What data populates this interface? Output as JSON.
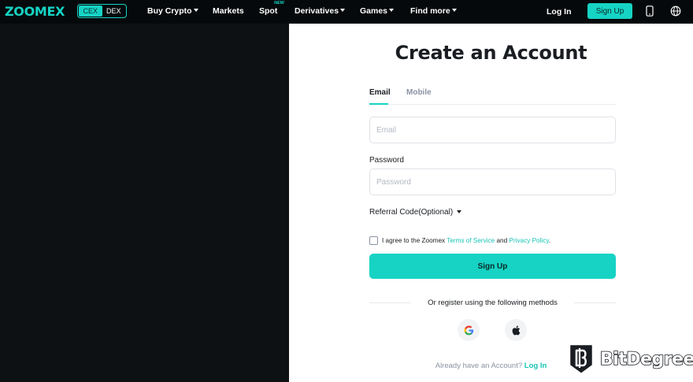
{
  "nav": {
    "logo": "ZOOMEX",
    "switch": {
      "cex": "CEX",
      "dex": "DEX"
    },
    "items": [
      {
        "label": "Buy Crypto",
        "dropdown": true
      },
      {
        "label": "Markets",
        "dropdown": false
      },
      {
        "label": "Spot",
        "dropdown": false,
        "badge": "NEW"
      },
      {
        "label": "Derivatives",
        "dropdown": true
      },
      {
        "label": "Games",
        "dropdown": true
      },
      {
        "label": "Find more",
        "dropdown": true
      }
    ],
    "login": "Log In",
    "signup": "Sign Up",
    "icons": [
      "mobile-icon",
      "globe-icon"
    ]
  },
  "form": {
    "title": "Create an Account",
    "tabs": [
      {
        "label": "Email",
        "active": true
      },
      {
        "label": "Mobile",
        "active": false
      }
    ],
    "email_placeholder": "Email",
    "password_label": "Password",
    "password_placeholder": "Password",
    "referral_label": "Referral Code(Optional)",
    "agree_prefix": "I agree to the Zoomex",
    "terms_link": "Terms of Service",
    "and": "and",
    "privacy_link": "Privacy Policy",
    "agree_suffix": ".",
    "signup_button": "Sign Up",
    "divider_text": "Or register using the following methods",
    "social": [
      "google-icon",
      "apple-icon"
    ],
    "already_text": "Already have an Account?",
    "login_link": "Log In"
  },
  "watermark": {
    "text": "BitDegree"
  },
  "colors": {
    "accent": "#16d3c4",
    "nav_bg": "#06090b",
    "left_bg": "#0d1114",
    "text": "#1a1d22",
    "muted": "#8a93a3"
  }
}
